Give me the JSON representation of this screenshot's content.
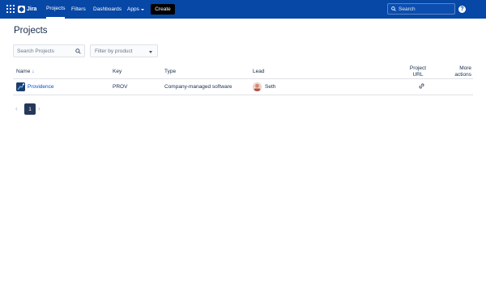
{
  "nav": {
    "logo_text": "Jira",
    "items": [
      {
        "label": "Projects"
      },
      {
        "label": "Filters"
      },
      {
        "label": "Dashboards"
      },
      {
        "label": "Apps"
      }
    ],
    "create_label": "Create",
    "search_placeholder": "Search",
    "help_label": "?",
    "brand_color": "#0747a6"
  },
  "page": {
    "title": "Projects"
  },
  "filters": {
    "search_placeholder": "Search Projects",
    "product_placeholder": "Filter by product"
  },
  "table": {
    "columns": [
      "Name",
      "Key",
      "Type",
      "Lead",
      "Project URL",
      "More actions"
    ],
    "sort_indicator": "↓",
    "rows": [
      {
        "name": "Providence",
        "key": "PROV",
        "type": "Company-managed software",
        "lead": "Seth",
        "url_icon": "link-icon"
      }
    ]
  },
  "pagination": {
    "current_page": "1",
    "prev_icon": "chevron-left-icon",
    "next_icon": "chevron-right-icon"
  }
}
